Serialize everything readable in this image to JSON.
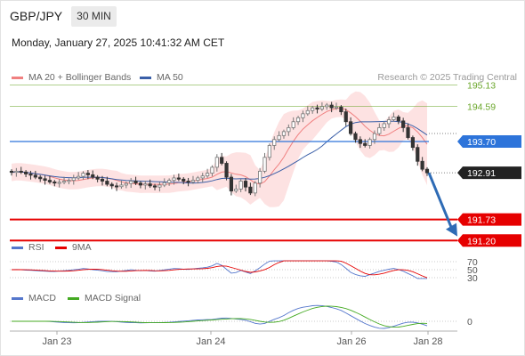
{
  "header": {
    "symbol": "GBP/JPY",
    "timeframe": "30 MIN",
    "datetime": "Monday, January 27, 2025 10:41:32 AM CET"
  },
  "legend": {
    "ma20": "MA 20 + Bollinger Bands",
    "ma50": "MA 50",
    "copyright": "Research © 2025 Trading Central",
    "rsi": "RSI",
    "rsi_ma": "9MA",
    "macd": "MACD",
    "macd_signal": "MACD Signal"
  },
  "colors": {
    "resistance": "#6aa62a",
    "pivot": "#2d74da",
    "support": "#e60000",
    "last": "#222222",
    "candle_up": "#777777",
    "candle_down": "#333333",
    "ma20": "#f08080",
    "ma50": "#3a5fa8",
    "bollinger_fill": "#fcd8d8",
    "arrow": "#2e6bb5"
  },
  "chart_data": {
    "type": "candlestick",
    "instrument": "GBP/JPY",
    "x_ticks": [
      "Jan 23",
      "Jan 24",
      "Jan 26",
      "Jan 28"
    ],
    "y_range": [
      190.9,
      195.4
    ],
    "levels": [
      {
        "label": "195.13",
        "value": 195.13,
        "kind": "resistance"
      },
      {
        "label": "194.59",
        "value": 194.59,
        "kind": "resistance"
      },
      {
        "label": "193.70",
        "value": 193.7,
        "kind": "pivot"
      },
      {
        "label": "192.91",
        "value": 192.91,
        "kind": "last"
      },
      {
        "label": "191.73",
        "value": 191.73,
        "kind": "support"
      },
      {
        "label": "191.20",
        "value": 191.2,
        "kind": "support"
      }
    ],
    "close_series": [
      192.92,
      192.95,
      192.93,
      192.88,
      192.85,
      192.8,
      192.76,
      192.72,
      192.68,
      192.65,
      192.67,
      192.7,
      192.72,
      192.78,
      192.82,
      192.9,
      192.86,
      192.8,
      192.75,
      192.7,
      192.62,
      192.58,
      192.56,
      192.6,
      192.64,
      192.7,
      192.65,
      192.6,
      192.63,
      192.58,
      192.55,
      192.6,
      192.66,
      192.72,
      192.78,
      192.75,
      192.7,
      192.68,
      192.72,
      192.78,
      192.83,
      192.9,
      193.05,
      193.3,
      193.15,
      192.8,
      192.45,
      192.5,
      192.7,
      192.55,
      192.4,
      192.65,
      192.95,
      193.3,
      193.6,
      193.75,
      193.85,
      193.95,
      194.05,
      194.2,
      194.3,
      194.4,
      194.48,
      194.55,
      194.52,
      194.58,
      194.62,
      194.55,
      194.57,
      194.45,
      194.2,
      193.9,
      193.75,
      193.65,
      193.6,
      193.75,
      193.9,
      194.05,
      194.15,
      194.25,
      194.32,
      194.22,
      194.05,
      193.8,
      193.55,
      193.2,
      193.0,
      192.91
    ],
    "projection": {
      "from": 192.91,
      "to": 191.35
    },
    "rsi": {
      "levels": [
        70,
        50,
        30
      ]
    },
    "macd": {
      "levels": [
        0
      ]
    }
  }
}
